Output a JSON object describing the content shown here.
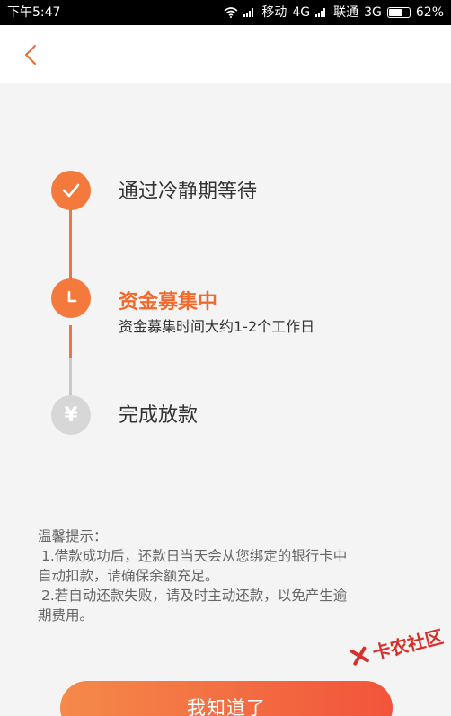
{
  "status_bar": {
    "time": "下午5:47",
    "carrier1": "移动",
    "network1": "4G",
    "carrier2": "联通",
    "network2": "3G",
    "battery": "62%",
    "battery_level": 0.62
  },
  "nav": {
    "back_icon": "chevron-left-icon"
  },
  "steps": [
    {
      "title": "通过冷静期等待",
      "state": "done",
      "icon": "check-icon"
    },
    {
      "title": "资金募集中",
      "subtitle": "资金募集时间大约1-2个工作日",
      "state": "active",
      "icon": "clock-icon"
    },
    {
      "title": "完成放款",
      "state": "pending",
      "icon": "yen-icon",
      "icon_text": "¥"
    }
  ],
  "tips": {
    "heading": "温馨提示：",
    "item1_line1": "1.借款成功后，还款日当天会从您绑定的银行卡中",
    "item1_line2": "自动扣款，请确保余额充足。",
    "item2_line1": "2.若自动还款失败，请及时主动还款，以免产生逾",
    "item2_line2": "期费用。"
  },
  "cta": {
    "label": "我知道了"
  },
  "watermark": {
    "text": "卡农社区"
  },
  "colors": {
    "accent": "#f2692d",
    "accent_gradient_start": "#f48a4a",
    "accent_gradient_end": "#f2543a",
    "pending": "#d7d7d7"
  }
}
